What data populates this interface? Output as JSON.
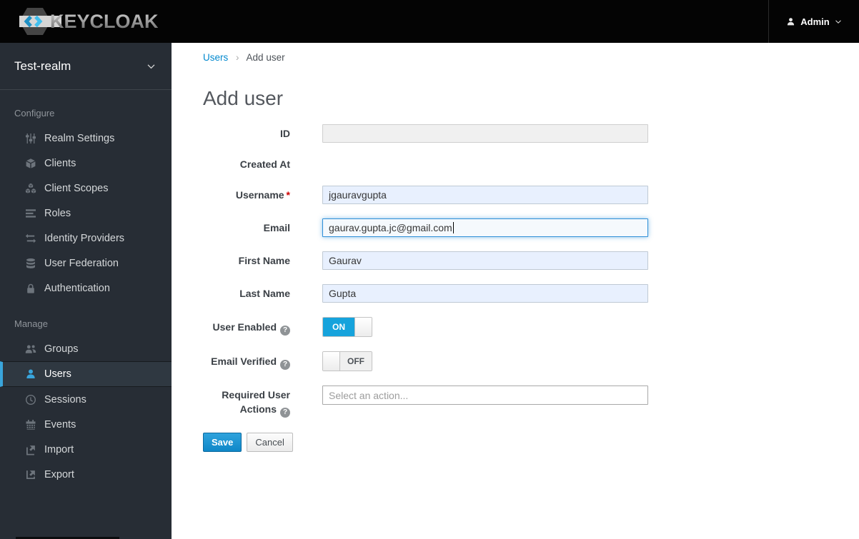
{
  "app": {
    "logo_text": "KEYCLOAK"
  },
  "header": {
    "user_menu": {
      "label": "Admin",
      "icon": "user-icon",
      "caret": "chevron-down-icon"
    }
  },
  "sidebar": {
    "realm_selector": {
      "label": "Test-realm",
      "caret": "chevron-down-icon"
    },
    "sections": [
      {
        "label": "Configure",
        "items": [
          {
            "label": "Realm Settings",
            "icon": "sliders-icon"
          },
          {
            "label": "Clients",
            "icon": "cube-icon"
          },
          {
            "label": "Client Scopes",
            "icon": "cubes-icon"
          },
          {
            "label": "Roles",
            "icon": "list-icon"
          },
          {
            "label": "Identity Providers",
            "icon": "exchange-icon"
          },
          {
            "label": "User Federation",
            "icon": "database-icon"
          },
          {
            "label": "Authentication",
            "icon": "lock-icon"
          }
        ]
      },
      {
        "label": "Manage",
        "items": [
          {
            "label": "Groups",
            "icon": "users-icon"
          },
          {
            "label": "Users",
            "icon": "user-icon",
            "active": true
          },
          {
            "label": "Sessions",
            "icon": "clock-icon"
          },
          {
            "label": "Events",
            "icon": "calendar-icon"
          },
          {
            "label": "Import",
            "icon": "import-icon"
          },
          {
            "label": "Export",
            "icon": "export-icon"
          }
        ]
      }
    ]
  },
  "breadcrumb": {
    "parent": "Users",
    "separator": "›",
    "current": "Add user"
  },
  "page": {
    "title": "Add user"
  },
  "icons": {
    "help_glyph": "?"
  },
  "form": {
    "id": {
      "label": "ID",
      "value": ""
    },
    "created_at": {
      "label": "Created At"
    },
    "username": {
      "label": "Username",
      "required_marker": "*",
      "value": "jgauravgupta"
    },
    "email": {
      "label": "Email",
      "value": "gaurav.gupta.jc@gmail.com",
      "focused": true
    },
    "first_name": {
      "label": "First Name",
      "value": "Gaurav"
    },
    "last_name": {
      "label": "Last Name",
      "value": "Gupta"
    },
    "user_enabled": {
      "label": "User Enabled",
      "state": "ON"
    },
    "email_verified": {
      "label": "Email Verified",
      "state": "OFF"
    },
    "required_user_actions": {
      "label_line1": "Required User",
      "label_line2": "Actions",
      "placeholder": "Select an action..."
    }
  },
  "actions": {
    "save": "Save",
    "cancel": "Cancel"
  },
  "colors": {
    "accent": "#0088ce",
    "toggle_on": "#16a3dc",
    "active_indicator": "#39a5dc",
    "link": "#0088ce",
    "required": "#cc0000",
    "sidebar_bg": "#272d35",
    "header_bg": "#040404",
    "autofill_bg": "#e8f0fe"
  }
}
